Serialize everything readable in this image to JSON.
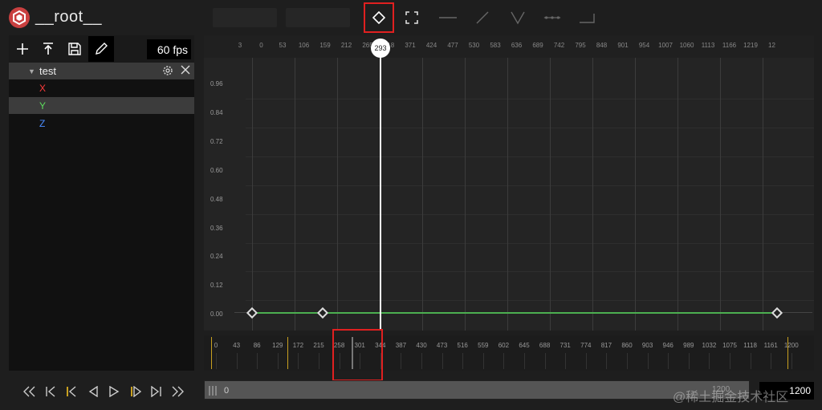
{
  "colors": {
    "accent_red": "#e02020",
    "curve_green": "#4caf50",
    "channel_x": "#ff3b3b",
    "channel_y": "#5ddc5d",
    "channel_z": "#4a8cff",
    "marker_yellow": "#c8a020"
  },
  "header": {
    "title": "__root__",
    "logo_icon": "cube-logo-icon",
    "tools": [
      "add-keyframe-icon",
      "fit-view-icon",
      "constant-curve-icon",
      "linear-curve-icon",
      "vee-curve-icon",
      "smooth-curve-icon",
      "step-curve-icon"
    ]
  },
  "left_toolbar": {
    "buttons": [
      "plus-icon",
      "import-icon",
      "save-icon",
      "edit-icon"
    ],
    "fps": "60 fps"
  },
  "tracks": [
    {
      "name": "test",
      "channels": [
        {
          "label": "X",
          "selected": false
        },
        {
          "label": "Y",
          "selected": true
        },
        {
          "label": "Z",
          "selected": false
        }
      ]
    }
  ],
  "curve_editor": {
    "ruler_ticks": [
      "3",
      "0",
      "53",
      "106",
      "159",
      "212",
      "265",
      "318",
      "371",
      "424",
      "477",
      "530",
      "583",
      "636",
      "689",
      "742",
      "795",
      "848",
      "901",
      "954",
      "1007",
      "1060",
      "1113",
      "1166",
      "1219",
      "12"
    ],
    "y_labels": [
      "0.96",
      "0.84",
      "0.72",
      "0.60",
      "0.48",
      "0.36",
      "0.24",
      "0.12",
      "0.00"
    ],
    "playhead": "293",
    "keyframe_values": [
      0.0,
      0.0,
      0.0
    ]
  },
  "timeline": {
    "ticks": [
      "0",
      "43",
      "86",
      "129",
      "172",
      "215",
      "258",
      "301",
      "344",
      "387",
      "430",
      "473",
      "516",
      "559",
      "602",
      "645",
      "688",
      "731",
      "774",
      "817",
      "860",
      "903",
      "946",
      "989",
      "1032",
      "1075",
      "1118",
      "1161",
      "1200"
    ]
  },
  "transport": {
    "buttons": [
      "skip-start-icon",
      "prev-key-icon",
      "prev-marker-icon",
      "prev-frame-icon",
      "play-icon",
      "next-marker-icon",
      "next-key-icon",
      "skip-end-icon"
    ]
  },
  "scrollbar": {
    "start": "0",
    "end": "1200"
  },
  "total_frames": "1200",
  "watermark": "@稀土掘金技术社区"
}
